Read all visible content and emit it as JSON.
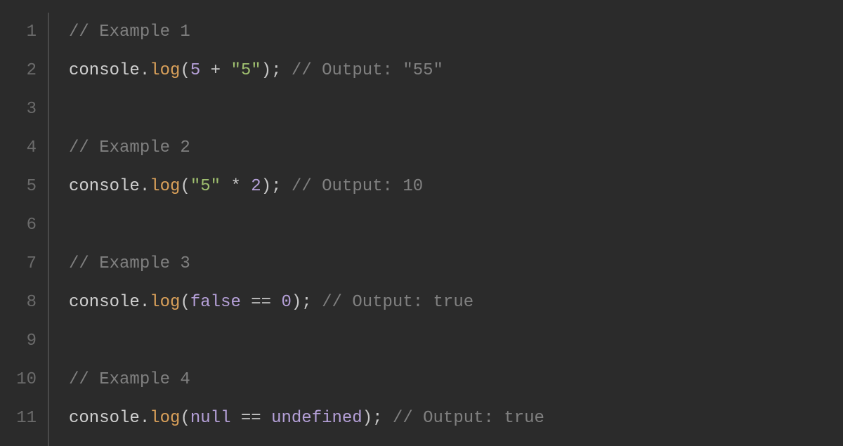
{
  "editor": {
    "gutter": [
      "1",
      "2",
      "3",
      "4",
      "5",
      "6",
      "7",
      "8",
      "9",
      "10",
      "11"
    ],
    "lines": [
      {
        "tokens": [
          {
            "cls": "tok-comment",
            "text": "// Example 1"
          }
        ]
      },
      {
        "tokens": [
          {
            "cls": "tok-identifier",
            "text": "console"
          },
          {
            "cls": "tok-punct",
            "text": "."
          },
          {
            "cls": "tok-method",
            "text": "log"
          },
          {
            "cls": "tok-punct",
            "text": "("
          },
          {
            "cls": "tok-number",
            "text": "5"
          },
          {
            "cls": "tok-operator",
            "text": " + "
          },
          {
            "cls": "tok-string",
            "text": "\"5\""
          },
          {
            "cls": "tok-punct",
            "text": ");"
          },
          {
            "cls": "tok-comment",
            "text": " // Output: \"55\""
          }
        ]
      },
      {
        "tokens": []
      },
      {
        "tokens": [
          {
            "cls": "tok-comment",
            "text": "// Example 2"
          }
        ]
      },
      {
        "tokens": [
          {
            "cls": "tok-identifier",
            "text": "console"
          },
          {
            "cls": "tok-punct",
            "text": "."
          },
          {
            "cls": "tok-method",
            "text": "log"
          },
          {
            "cls": "tok-punct",
            "text": "("
          },
          {
            "cls": "tok-string",
            "text": "\"5\""
          },
          {
            "cls": "tok-operator",
            "text": " * "
          },
          {
            "cls": "tok-number",
            "text": "2"
          },
          {
            "cls": "tok-punct",
            "text": ");"
          },
          {
            "cls": "tok-comment",
            "text": " // Output: 10"
          }
        ]
      },
      {
        "tokens": []
      },
      {
        "tokens": [
          {
            "cls": "tok-comment",
            "text": "// Example 3"
          }
        ]
      },
      {
        "tokens": [
          {
            "cls": "tok-identifier",
            "text": "console"
          },
          {
            "cls": "tok-punct",
            "text": "."
          },
          {
            "cls": "tok-method",
            "text": "log"
          },
          {
            "cls": "tok-punct",
            "text": "("
          },
          {
            "cls": "tok-literal",
            "text": "false"
          },
          {
            "cls": "tok-operator",
            "text": " == "
          },
          {
            "cls": "tok-number",
            "text": "0"
          },
          {
            "cls": "tok-punct",
            "text": ");"
          },
          {
            "cls": "tok-comment",
            "text": " // Output: true"
          }
        ]
      },
      {
        "tokens": []
      },
      {
        "tokens": [
          {
            "cls": "tok-comment",
            "text": "// Example 4"
          }
        ]
      },
      {
        "tokens": [
          {
            "cls": "tok-identifier",
            "text": "console"
          },
          {
            "cls": "tok-punct",
            "text": "."
          },
          {
            "cls": "tok-method",
            "text": "log"
          },
          {
            "cls": "tok-punct",
            "text": "("
          },
          {
            "cls": "tok-literal",
            "text": "null"
          },
          {
            "cls": "tok-operator",
            "text": " == "
          },
          {
            "cls": "tok-literal",
            "text": "undefined"
          },
          {
            "cls": "tok-punct",
            "text": ");"
          },
          {
            "cls": "tok-comment",
            "text": " // Output: true"
          }
        ]
      }
    ]
  }
}
